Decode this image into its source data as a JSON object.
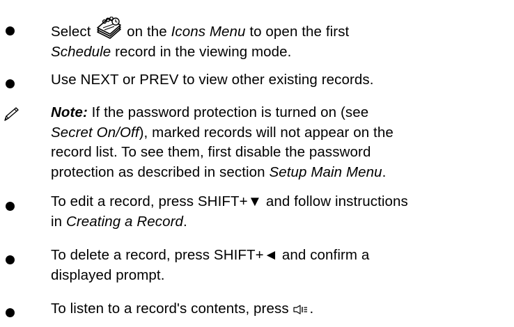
{
  "items": [
    {
      "type": "bullet",
      "parts": {
        "a": "Select ",
        "b": " on the ",
        "c": "Icons Menu",
        "d": " to open the first",
        "e": "Schedule",
        "f": " record in the viewing mode."
      },
      "icon": "schedule-notepad-icon"
    },
    {
      "type": "bullet",
      "text": "Use NEXT or PREV to view other existing records."
    },
    {
      "type": "note",
      "icon": "pencil-icon",
      "parts": {
        "label": "Note:",
        "a": " If the password protection is turned on (see",
        "b": "Secret On/Off",
        "c": "), marked records will not appear on the",
        "d": "record list. To see them, first disable the password",
        "e": "protection as described in section ",
        "f": "Setup Main Menu",
        "g": "."
      }
    },
    {
      "type": "bullet",
      "parts": {
        "a": "To edit a record, press SHIFT+▼ and follow instructions",
        "b": "in ",
        "c": "Creating a Record",
        "d": "."
      }
    },
    {
      "type": "bullet",
      "parts": {
        "a": "To delete a record, press SHIFT+◄ and confirm a",
        "b": "displayed prompt."
      }
    },
    {
      "type": "bullet",
      "parts": {
        "a": "To listen to a record's contents, press ",
        "b": "."
      },
      "icon": "speaker-key-icon"
    }
  ],
  "colors": {
    "text": "#000000",
    "background": "#ffffff"
  }
}
